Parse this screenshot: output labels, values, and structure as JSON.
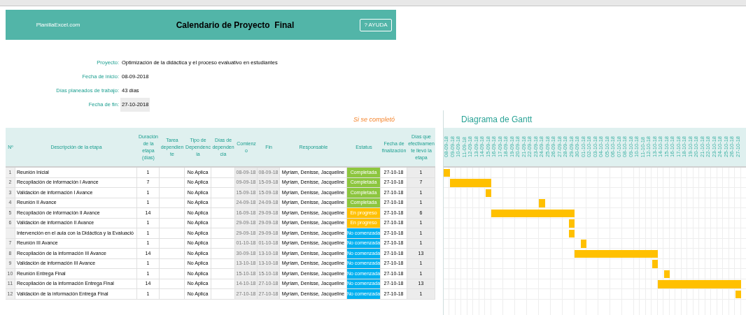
{
  "banner": {
    "site": "PlanillaExcel.com",
    "title": "Calendario de Proyecto  Final",
    "help_button": "? AYUDA"
  },
  "project_info": [
    {
      "label": "Proyecto:",
      "value": "Optimización de la didáctica y el proceso evaluativo en estudiantes",
      "highlighted": false
    },
    {
      "label": "Fecha de inicio:",
      "value": "08-09-2018",
      "highlighted": false
    },
    {
      "label": "Días planeados de trabajo:",
      "value": "43 días",
      "highlighted": false
    },
    {
      "label": "Fecha de fin:",
      "value": "27-10-2018",
      "highlighted": true
    }
  ],
  "completion_note": "Si se completó",
  "table": {
    "columns": [
      "Nº",
      "Descripción de la etapa",
      "Duración de la etapa (días)",
      "Tarea dependiente",
      "Tipo de Dependencia",
      "Días de dependencia",
      "Comienzo",
      "Fin",
      "Responsable",
      "Estatus",
      "Fecha de finalización",
      "Días que efectivamente llevó la etapa"
    ],
    "rows": [
      {
        "number": "1",
        "description": "Reunión Inicial",
        "duration": "1",
        "dependency_type": "No Aplica",
        "start": "08-09-18",
        "end": "08-09-18",
        "responsible": "Myriam, Denisse, Jacqueline",
        "status": {
          "label": "Completada",
          "kind": "completed"
        },
        "finish_date": "27-10-18",
        "actual_days": "1"
      },
      {
        "number": "2",
        "description": "Recopilación de información I Avance",
        "duration": "7",
        "dependency_type": "No Aplica",
        "start": "09-09-18",
        "end": "15-09-18",
        "responsible": "Myriam, Denisse, Jacqueline",
        "status": {
          "label": "Completada",
          "kind": "completed"
        },
        "finish_date": "27-10-18",
        "actual_days": "7"
      },
      {
        "number": "3",
        "description": "Validación de información I Avance",
        "duration": "1",
        "dependency_type": "No Aplica",
        "start": "15-09-18",
        "end": "15-09-18",
        "responsible": "Myriam, Denisse, Jacqueline",
        "status": {
          "label": "Completada",
          "kind": "completed"
        },
        "finish_date": "27-10-18",
        "actual_days": "1"
      },
      {
        "number": "4",
        "description": "Reunión II Avance",
        "duration": "1",
        "dependency_type": "No Aplica",
        "start": "24-09-18",
        "end": "24-09-18",
        "responsible": "Myriam, Denisse, Jacqueline",
        "status": {
          "label": "Completada",
          "kind": "completed"
        },
        "finish_date": "27-10-18",
        "actual_days": "1"
      },
      {
        "number": "5",
        "description": "Recopilación de información II Avance",
        "duration": "14",
        "dependency_type": "No Aplica",
        "start": "16-09-18",
        "end": "29-09-18",
        "responsible": "Myriam, Denisse, Jacqueline",
        "status": {
          "label": "En progreso",
          "kind": "in_progress"
        },
        "finish_date": "27-10-18",
        "actual_days": "6"
      },
      {
        "number": "6",
        "description": "Validación de información II Avance",
        "duration": "1",
        "dependency_type": "No Aplica",
        "start": "29-09-18",
        "end": "29-09-18",
        "responsible": "Myriam, Denisse, Jacqueline",
        "status": {
          "label": "En progreso",
          "kind": "in_progress"
        },
        "finish_date": "27-10-18",
        "actual_days": "1"
      },
      {
        "description": "Intervención en el aula con la Didáctica y la Evaluació",
        "duration": "1",
        "dependency_type": "No Aplica",
        "start": "29-09-18",
        "end": "29-09-18",
        "responsible": "Myriam, Denisse, Jacqueline",
        "status": {
          "label": "No comenzada",
          "kind": "not_started"
        },
        "finish_date": "27-10-18",
        "actual_days": "1"
      },
      {
        "number": "7",
        "description": "Reunión III Avance",
        "duration": "1",
        "dependency_type": "No Aplica",
        "start": "01-10-18",
        "end": "01-10-18",
        "responsible": "Myriam, Denisse, Jacqueline",
        "status": {
          "label": "No comenzada",
          "kind": "not_started"
        },
        "finish_date": "27-10-18",
        "actual_days": "1"
      },
      {
        "number": "8",
        "description": "Recopilación de la información III Avance",
        "duration": "14",
        "dependency_type": "No Aplica",
        "start": "30-09-18",
        "end": "13-10-18",
        "responsible": "Myriam, Denisse, Jacqueline",
        "status": {
          "label": "No comenzada",
          "kind": "not_started"
        },
        "finish_date": "27-10-18",
        "actual_days": "13"
      },
      {
        "number": "9",
        "description": "Validación de información III Avance",
        "duration": "1",
        "dependency_type": "No Aplica",
        "start": "13-10-18",
        "end": "13-10-18",
        "responsible": "Myriam, Denisse, Jacqueline",
        "status": {
          "label": "No comenzada",
          "kind": "not_started"
        },
        "finish_date": "27-10-18",
        "actual_days": "1"
      },
      {
        "number": "10",
        "description": "Reunión Entrega Final",
        "duration": "1",
        "dependency_type": "No Aplica",
        "start": "15-10-18",
        "end": "15-10-18",
        "responsible": "Myriam, Denisse, Jacqueline",
        "status": {
          "label": "No comenzada",
          "kind": "not_started"
        },
        "finish_date": "27-10-18",
        "actual_days": "1"
      },
      {
        "number": "11",
        "description": "Recopilación de la información Entrega Final",
        "duration": "14",
        "dependency_type": "No Aplica",
        "start": "14-10-18",
        "end": "27-10-18",
        "responsible": "Myriam, Denisse, Jacqueline",
        "status": {
          "label": "No comenzada",
          "kind": "not_started"
        },
        "finish_date": "27-10-18",
        "actual_days": "13"
      },
      {
        "number": "12",
        "description": "Validación de la información Entrega Final",
        "duration": "1",
        "dependency_type": "No Aplica",
        "start": "27-10-18",
        "end": "27-10-18",
        "responsible": "Myriam, Denisse, Jacqueline",
        "status": {
          "label": "No comenzada",
          "kind": "not_started"
        },
        "finish_date": "27-10-18",
        "actual_days": "1"
      }
    ]
  },
  "gantt": {
    "title": "Diagrama de Gantt",
    "dates": [
      "08-09-18",
      "09-09-18",
      "10-09-18",
      "11-09-18",
      "12-09-18",
      "13-09-18",
      "14-09-18",
      "15-09-18",
      "16-09-18",
      "17-09-18",
      "18-09-18",
      "19-09-18",
      "20-09-18",
      "21-09-18",
      "22-09-18",
      "23-09-18",
      "24-09-18",
      "25-09-18",
      "26-09-18",
      "27-09-18",
      "28-09-18",
      "29-09-18",
      "30-09-18",
      "01-10-18",
      "02-10-18",
      "03-10-18",
      "04-10-18",
      "05-10-18",
      "06-10-18",
      "07-10-18",
      "08-10-18",
      "09-10-18",
      "10-10-18",
      "11-10-18",
      "12-10-18",
      "13-10-18",
      "14-10-18",
      "15-10-18",
      "16-10-18",
      "17-10-18",
      "18-10-18",
      "19-10-18",
      "20-10-18",
      "21-10-18",
      "22-10-18",
      "23-10-18",
      "24-10-18",
      "25-10-18",
      "26-10-18",
      "27-10-18"
    ]
  }
}
